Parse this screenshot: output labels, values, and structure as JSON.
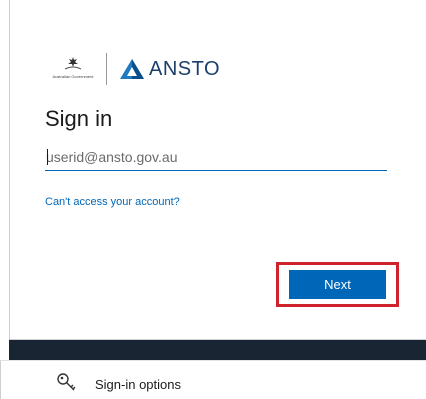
{
  "logos": {
    "government_text": "Australian Government",
    "ansto_name": "ANSTO",
    "ansto_color": "#1c3e6e"
  },
  "signin": {
    "title": "Sign in",
    "email_placeholder": "userid@ansto.gov.au",
    "cant_access_link": "Can't access your account?",
    "next_label": "Next"
  },
  "footer": {
    "options_label": "Sign-in options",
    "options_icon": "key-icon"
  },
  "colors": {
    "accent": "#0067b8",
    "highlight_border": "#d0222c",
    "dark_band": "#1a2533"
  }
}
